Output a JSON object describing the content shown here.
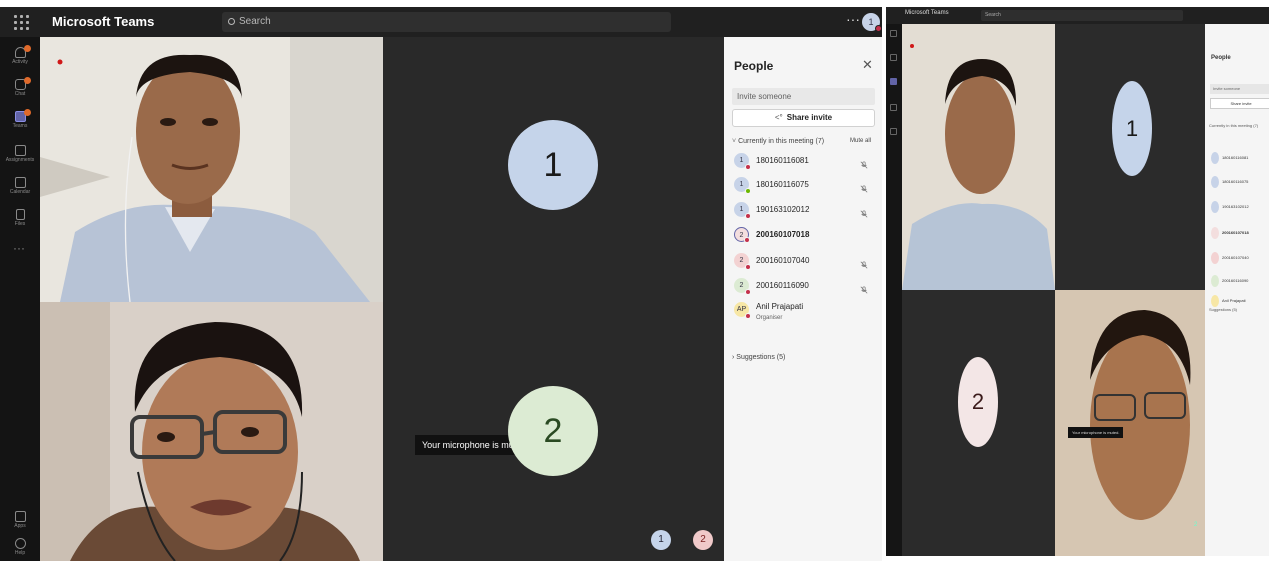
{
  "app": {
    "title": "Microsoft Teams",
    "search_placeholder": "Search",
    "more_label": "···",
    "user_initial": "1"
  },
  "rail": {
    "items": [
      {
        "label": "Activity",
        "icon": "bell-icon",
        "badge": true
      },
      {
        "label": "Chat",
        "icon": "chat-icon",
        "badge": true
      },
      {
        "label": "Teams",
        "icon": "teams-icon",
        "badge": true,
        "active": true
      },
      {
        "label": "Assignments",
        "icon": "assignments-icon"
      },
      {
        "label": "Calendar",
        "icon": "calendar-icon"
      },
      {
        "label": "Files",
        "icon": "file-icon"
      }
    ],
    "more_label": "···",
    "bottom": [
      {
        "label": "Apps",
        "icon": "apps-icon"
      },
      {
        "label": "Help",
        "icon": "help-icon"
      }
    ]
  },
  "stage": {
    "tile_numbers": [
      "1",
      "2"
    ],
    "toast": "Your microphone is muted.",
    "mini_avatars": [
      "1",
      "2"
    ]
  },
  "people_panel": {
    "title": "People",
    "close_label": "✕",
    "invite_placeholder": "Invite someone",
    "share_label": "Share invite",
    "section_header": "Currently in this meeting (7)",
    "mute_all": "Mute all",
    "participants": [
      {
        "initial": "1",
        "name": "180160116081",
        "status": "#c4314b",
        "avatar_color": "#c7d3e8",
        "muted": true,
        "bold": false
      },
      {
        "initial": "1",
        "name": "180160116075",
        "status": "#6bb700",
        "avatar_color": "#c7d3e8",
        "muted": true,
        "bold": false
      },
      {
        "initial": "1",
        "name": "190163102012",
        "status": "#c4314b",
        "avatar_color": "#c7d3e8",
        "muted": true,
        "bold": false
      },
      {
        "initial": "2",
        "name": "200160107018",
        "status": "#c4314b",
        "avatar_color": "#f3dede",
        "muted": false,
        "bold": true
      },
      {
        "initial": "2",
        "name": "200160107040",
        "status": "#c4314b",
        "avatar_color": "#f3d2d2",
        "muted": true,
        "bold": false
      },
      {
        "initial": "2",
        "name": "200160116090",
        "status": "#c4314b",
        "avatar_color": "#dcebd3",
        "muted": true,
        "bold": false
      },
      {
        "initial": "AP",
        "name": "Anil Prajapati",
        "role": "Organiser",
        "status": "#c4314b",
        "avatar_color": "#f7e7a6",
        "muted": false,
        "bold": false
      }
    ],
    "suggestions": "Suggestions (5)"
  },
  "colors": {
    "accent": "#6264a7",
    "busy": "#c4314b",
    "available": "#6bb700"
  }
}
